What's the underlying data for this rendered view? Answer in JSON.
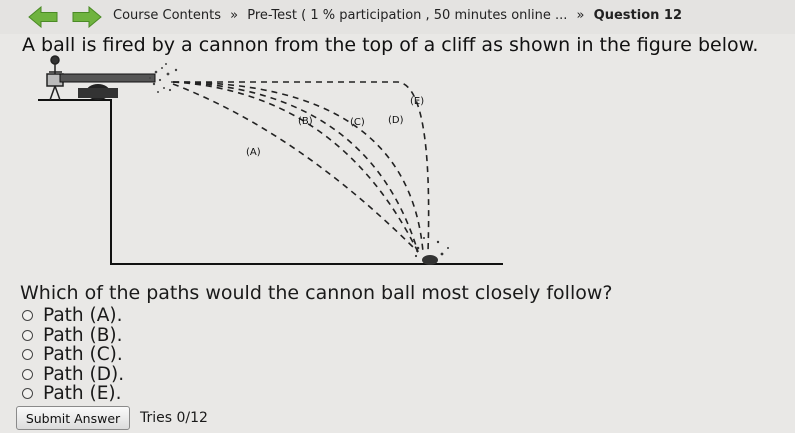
{
  "breadcrumb": {
    "course_contents": "Course Contents",
    "separator": "»",
    "pretest": "Pre-Test ( 1 % participation , 50 minutes online ...",
    "question": "Question 12"
  },
  "question": {
    "text": "A ball is fired by a cannon from the top of a cliff as shown in the figure below.",
    "prompt": "Which of the paths would the cannon ball most closely follow?",
    "options": [
      "Path (A).",
      "Path (B).",
      "Path (C).",
      "Path (D).",
      "Path (E)."
    ]
  },
  "figure": {
    "path_labels": [
      "(A)",
      "(B)",
      "(C)",
      "(D)",
      "(E)"
    ]
  },
  "controls": {
    "submit_label": "Submit Answer",
    "tries": "Tries 0/12"
  },
  "icons": {
    "back": "back-arrow-icon",
    "forward": "forward-arrow-icon"
  },
  "colors": {
    "nav_arrow": "#6fb33f",
    "background": "#e9e8e6"
  }
}
